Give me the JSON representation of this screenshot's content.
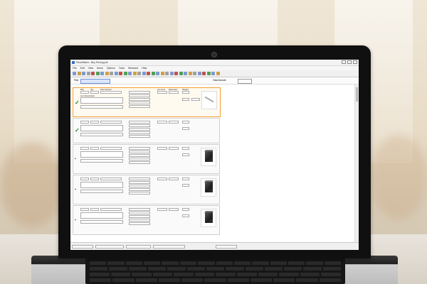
{
  "app": {
    "title": "PriceWatch - Buy Pricing.pdf",
    "menu": [
      "File",
      "Edit",
      "View",
      "Items",
      "Options",
      "Tools",
      "Windows",
      "Help"
    ],
    "filter_label": "Find",
    "filter_value": "",
    "filter_right_label": "Total Amount"
  },
  "items": [
    {
      "status": "check",
      "selected": true,
      "labels": {
        "mfg": "Mfg",
        "qty": "Qty",
        "part": "Part Number",
        "desc": "Item Description",
        "list": "List Cost",
        "extended": "Extended",
        "weight": "Weight"
      }
    },
    {
      "status": "check",
      "selected": false
    },
    {
      "status": "note",
      "selected": false
    },
    {
      "status": "note",
      "selected": false
    },
    {
      "status": "note",
      "selected": false
    }
  ],
  "statusbar": {
    "fields": [
      "",
      "",
      "",
      "",
      ""
    ]
  },
  "colors": {
    "selection": "#f0a030",
    "check": "#1a8a2a",
    "filter_highlight": "#dbe6fb"
  }
}
